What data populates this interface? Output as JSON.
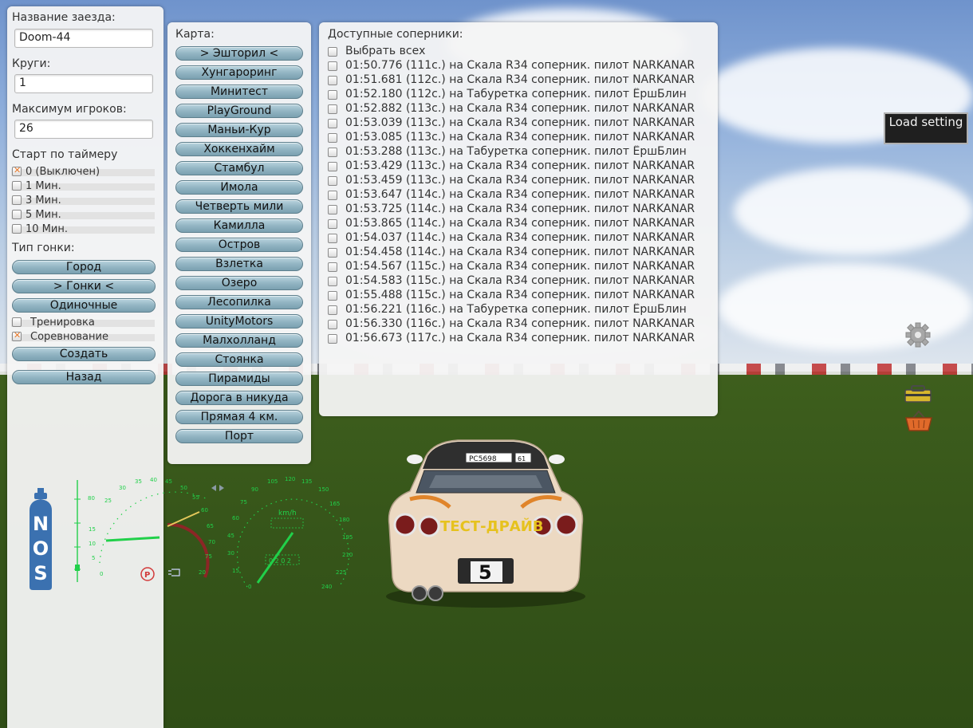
{
  "left_panel": {
    "race_name_label": "Название заезда:",
    "race_name_value": "Doom-44",
    "laps_label": "Круги:",
    "laps_value": "1",
    "max_players_label": "Максимум игроков:",
    "max_players_value": "26",
    "timer_label": "Старт по таймеру",
    "timer_options": [
      {
        "label": "0 (Выключен)",
        "checked": true
      },
      {
        "label": "1 Мин.",
        "checked": false
      },
      {
        "label": "3 Мин.",
        "checked": false
      },
      {
        "label": "5 Мин.",
        "checked": false
      },
      {
        "label": "10 Мин.",
        "checked": false
      }
    ],
    "race_type_label": "Тип гонки:",
    "race_type_buttons": [
      "Город",
      "> Гонки <",
      "Одиночные"
    ],
    "mode_options": [
      {
        "label": "Тренировка",
        "checked": false
      },
      {
        "label": "Соревнование",
        "checked": true
      }
    ],
    "create_button": "Создать",
    "back_button": "Назад"
  },
  "map_panel": {
    "label": "Карта:",
    "maps": [
      "> Эшторил <",
      "Хунгароринг",
      "Минитест",
      "PlayGround",
      "Маньи-Кур",
      "Хоккенхайм",
      "Стамбул",
      "Имола",
      "Четверть мили",
      "Камилла",
      "Остров",
      "Взлетка",
      "Озеро",
      "Лесопилка",
      "UnityMotors",
      "Малхолланд",
      "Стоянка",
      "Пирамиды",
      "Дорога в никуда",
      "Прямая 4 км.",
      "Порт"
    ]
  },
  "rivals_panel": {
    "label": "Доступные соперники:",
    "select_all": "Выбрать всех",
    "rivals": [
      "01:50.776 (111с.) на Скала R34 соперник. пилот NARKANAR",
      "01:51.681 (112с.) на Скала R34 соперник. пилот NARKANAR",
      "01:52.180 (112с.) на Табуретка соперник. пилот ЁршБлин",
      "01:52.882 (113с.) на Скала R34 соперник. пилот NARKANAR",
      "01:53.039 (113с.) на Скала R34 соперник. пилот NARKANAR",
      "01:53.085 (113с.) на Скала R34 соперник. пилот NARKANAR",
      "01:53.288 (113с.) на Табуретка соперник. пилот ЁршБлин",
      "01:53.429 (113с.) на Скала R34 соперник. пилот NARKANAR",
      "01:53.459 (113с.) на Скала R34 соперник. пилот NARKANAR",
      "01:53.647 (114с.) на Скала R34 соперник. пилот NARKANAR",
      "01:53.725 (114с.) на Скала R34 соперник. пилот NARKANAR",
      "01:53.865 (114с.) на Скала R34 соперник. пилот NARKANAR",
      "01:54.037 (114с.) на Скала R34 соперник. пилот NARKANAR",
      "01:54.458 (114с.) на Скала R34 соперник. пилот NARKANAR",
      "01:54.567 (115с.) на Скала R34 соперник. пилот NARKANAR",
      "01:54.583 (115с.) на Скала R34 соперник. пилот NARKANAR",
      "01:55.488 (115с.) на Скала R34 соперник. пилот NARKANAR",
      "01:56.221 (116с.) на Табуретка соперник. пилот ЁршБлин",
      "01:56.330 (116с.) на Скала R34 соперник. пилот NARKANAR",
      "01:56.673 (117с.) на Скала R34 соперник. пилот NARKANAR"
    ]
  },
  "load_setting": "Load setting",
  "hud": {
    "nos_letters": [
      "N",
      "O",
      "S"
    ],
    "speed_unit": "km/h",
    "speed_ticks": [
      "0",
      "15",
      "30",
      "45",
      "60",
      "75",
      "90",
      "105",
      "120",
      "135",
      "150",
      "165",
      "180",
      "195",
      "210",
      "225",
      "240"
    ],
    "rpm_ticks": [
      "0",
      "5",
      "10",
      "15",
      "20",
      "25",
      "30",
      "35",
      "40",
      "45",
      "50",
      "55",
      "60",
      "65",
      "70",
      "75",
      "80"
    ],
    "odometer": "0 2 0 2"
  },
  "car": {
    "plate_top": "PC5698",
    "plate_region": "61",
    "decal": "ТЕСТ-ДРАЙВ",
    "number": "5"
  },
  "colors": {
    "panel_bg": "#f4f4f4",
    "button_blue": "#93b5c3",
    "check_orange": "#e8792a",
    "gauge_green": "#21d04a",
    "nos_blue": "#3b71b0"
  }
}
